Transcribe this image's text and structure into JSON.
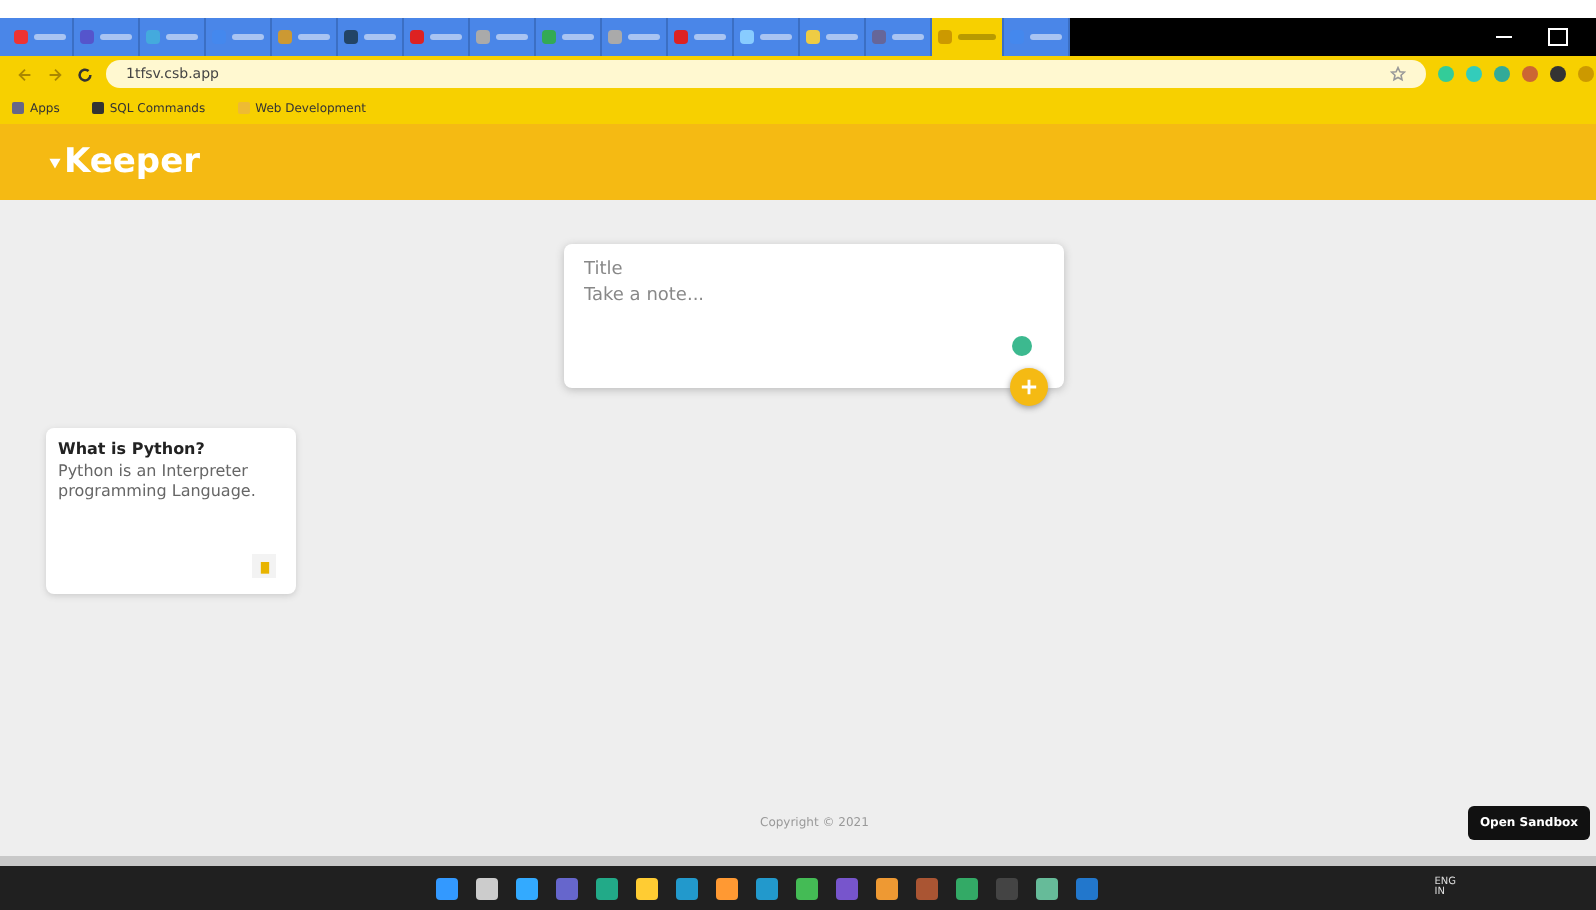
{
  "browser": {
    "url": "1tfsv.csb.app",
    "tabs": [
      {
        "selected": false
      },
      {
        "selected": false
      },
      {
        "selected": false
      },
      {
        "selected": false
      },
      {
        "selected": false
      },
      {
        "selected": false
      },
      {
        "selected": false
      },
      {
        "selected": false
      },
      {
        "selected": false
      },
      {
        "selected": false
      },
      {
        "selected": false
      },
      {
        "selected": false
      },
      {
        "selected": false
      },
      {
        "selected": false
      },
      {
        "selected": true
      },
      {
        "selected": false
      }
    ],
    "bookmarks": [
      {
        "label": "Apps"
      },
      {
        "label": "SQL Commands"
      },
      {
        "label": "Web Development"
      }
    ]
  },
  "app": {
    "logo": "Keeper",
    "composer": {
      "title_placeholder": "Title",
      "note_placeholder": "Take a note..."
    },
    "notes": [
      {
        "title": "What is Python?",
        "content": "Python is an Interpreter programming Language."
      }
    ],
    "footer": "Copyright © 2021",
    "sandbox_button": "Open Sandbox"
  },
  "taskbar": {
    "language": "ENG",
    "region": "IN"
  }
}
